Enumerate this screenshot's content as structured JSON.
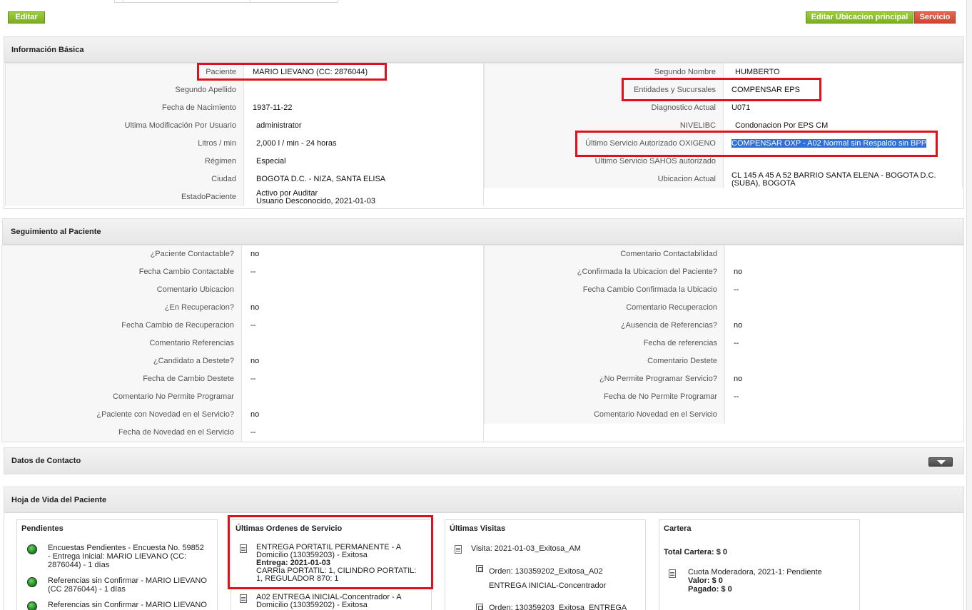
{
  "toolbar": {
    "edit_label": "Editar",
    "edit_location_label": "Editar Ubicacion principal",
    "service_label": "Servicio"
  },
  "basic_info": {
    "title": "Información Básica",
    "left": [
      {
        "label": "Paciente",
        "value": "MARIO LIEVANO (CC: 2876044)"
      },
      {
        "label": "Segundo Apellido",
        "value": ""
      },
      {
        "label": "Fecha de Nacimiento",
        "value": "1937-11-22"
      },
      {
        "label": "Ultima Modificación Por Usuario",
        "value": "administrator"
      },
      {
        "label": "Litros / min",
        "value": "2,000 l / min - 24 horas"
      },
      {
        "label": "Régimen",
        "value": "Especial"
      },
      {
        "label": "Ciudad",
        "value": "BOGOTA D.C. - NIZA, SANTA ELISA"
      },
      {
        "label": "EstadoPaciente",
        "value_line1": "Activo por Auditar",
        "value_line2": "Usuario Desconocido, 2021-01-03"
      }
    ],
    "right": [
      {
        "label": "Segundo Nombre",
        "value": "HUMBERTO"
      },
      {
        "label": "Entidades y Sucursales",
        "value": "COMPENSAR EPS"
      },
      {
        "label": "Diagnostico Actual",
        "value": "U071"
      },
      {
        "label": "NIVELIBC",
        "value": "Condonacion Por EPS CM"
      },
      {
        "label": "Último Servicio Autorizado OXIGENO",
        "value": "COMPENSAR OXP - A02 Normal sin Respaldo sin BPP"
      },
      {
        "label": "Ultimo Servicio SAHOS autorizado",
        "value": ""
      },
      {
        "label": "Ubicacion Actual",
        "value_line1": "CL 145 A 45 A 52 BARRIO SANTA ELENA - BOGOTA D.C.",
        "value_line2": "(SUBA), BOGOTA"
      }
    ]
  },
  "followup": {
    "title": "Seguimiento al Paciente",
    "left": [
      {
        "label": "¿Paciente Contactable?",
        "value": "no"
      },
      {
        "label": "Fecha Cambio Contactable",
        "value": "--"
      },
      {
        "label": "Comentario Ubicacion",
        "value": ""
      },
      {
        "label": "¿En Recuperacion?",
        "value": "no"
      },
      {
        "label": "Fecha Cambio de Recuperacion",
        "value": "--"
      },
      {
        "label": "Comentario Referencias",
        "value": ""
      },
      {
        "label": "¿Candidato a Destete?",
        "value": "no"
      },
      {
        "label": "Fecha de Cambio Destete",
        "value": "--"
      },
      {
        "label": "Comentario No Permite Programar",
        "value": ""
      },
      {
        "label": "¿Paciente con Novedad en el Servicio?",
        "value": "no"
      },
      {
        "label": "Fecha de Novedad en el Servicio",
        "value": "--"
      }
    ],
    "right": [
      {
        "label": "Comentario Contactabilidad",
        "value": ""
      },
      {
        "label": "¿Confirmada la Ubicacion del Paciente?",
        "value": "no"
      },
      {
        "label": "Fecha Cambio Confirmada la Ubicacio",
        "value": "--"
      },
      {
        "label": "Comentario Recuperacion",
        "value": ""
      },
      {
        "label": "¿Ausencia de Referencias?",
        "value": "no"
      },
      {
        "label": "Fecha de referencias",
        "value": "--"
      },
      {
        "label": "Comentario Destete",
        "value": ""
      },
      {
        "label": "¿No Permite Programar Servicio?",
        "value": "no"
      },
      {
        "label": "Fecha de No Permite Programar",
        "value": "--"
      },
      {
        "label": "Comentario Novedad en el Servicio",
        "value": ""
      }
    ]
  },
  "contact": {
    "title": "Datos de Contacto"
  },
  "history": {
    "title": "Hoja de Vida del Paciente",
    "pendientes": {
      "title": "Pendientes",
      "items": [
        {
          "line1": "Encuestas Pendientes - Encuesta No. 59852",
          "line2": "- Entrega Inicial: MARIO LIEVANO (CC:",
          "line3": "2876044) - 1 días"
        },
        {
          "line1": "Referencias sin Confirmar - MARIO LIEVANO",
          "line2": "(CC 2876044) - 1 días"
        },
        {
          "line1": "Referencias sin Confirmar - MARIO LIEVANO"
        }
      ]
    },
    "ordenes": {
      "title": "Últimas Ordenes de Servicio",
      "items": [
        {
          "line1": "ENTREGA PORTATIL PERMANENTE - A",
          "line2": "Domicilio (130359203) - Exitosa",
          "delivery_label": "Entrega:",
          "delivery_date": "2021-01-03",
          "line3": "CARRIa PORTATIL: 1, CILINDRO PORTATIL:",
          "line4": "1, REGULADOR 870: 1"
        },
        {
          "line1": "A02 ENTREGA INICIAL-Concentrador - A",
          "line2": "Domicilio (130359202) - Exitosa"
        }
      ]
    },
    "visitas": {
      "title": "Últimas Visitas",
      "visit": "Visita: 2021-01-03_Exitosa_AM",
      "orders": [
        {
          "line1": "Orden: 130359202_Exitosa_A02",
          "line2": "ENTREGA INICIAL-Concentrador"
        },
        {
          "line1": "Orden: 130359203_Exitosa_ENTREGA"
        }
      ]
    },
    "cartera": {
      "title": "Cartera",
      "total": "Total Cartera: $ 0",
      "item": "Cuota Moderadora, 2021-1: Pendiente",
      "valor": "Valor: $ 0",
      "pagado": "Pagado: $ 0"
    }
  }
}
